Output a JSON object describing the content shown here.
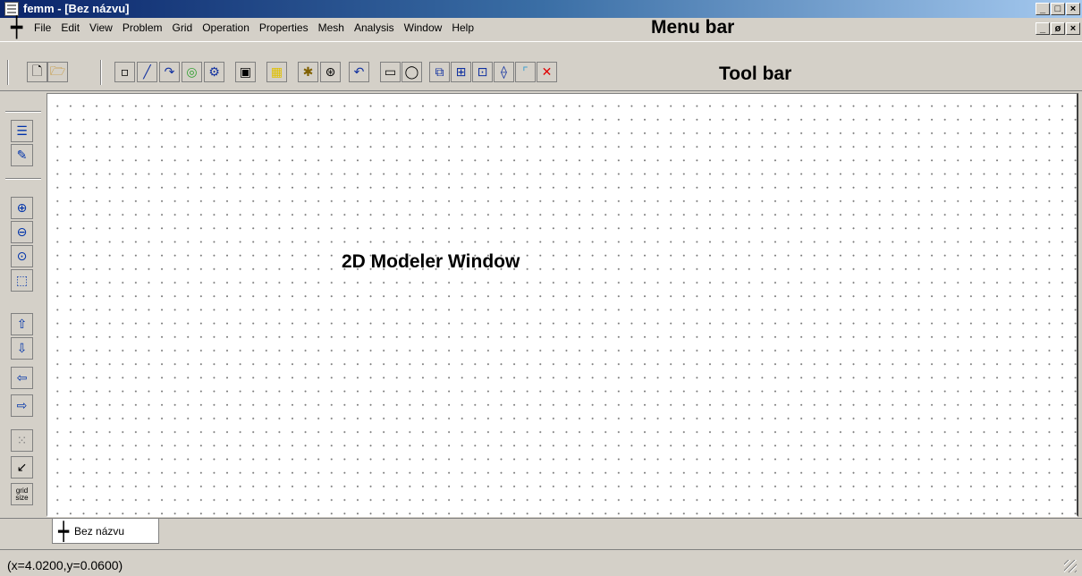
{
  "window": {
    "title": "femm - [Bez názvu]"
  },
  "caption_buttons": {
    "minimize": "_",
    "maximize": "□",
    "close": "×",
    "restore": "ø"
  },
  "menu": {
    "items": [
      {
        "label": "File"
      },
      {
        "label": "Edit"
      },
      {
        "label": "View"
      },
      {
        "label": "Problem"
      },
      {
        "label": "Grid"
      },
      {
        "label": "Operation"
      },
      {
        "label": "Properties"
      },
      {
        "label": "Mesh"
      },
      {
        "label": "Analysis"
      },
      {
        "label": "Window"
      },
      {
        "label": "Help"
      }
    ]
  },
  "annotations": {
    "menu_bar": "Menu bar",
    "tool_bar": "Tool bar",
    "modeler": "2D Modeler Window"
  },
  "toolbar_icons": [
    "new-file-icon",
    "open-folder-icon",
    "node-icon",
    "segment-icon",
    "arc-segment-icon",
    "block-label-icon",
    "group-icon",
    "properties-icon",
    "select-region-icon",
    "mesh-icon",
    "analyze-icon",
    "undo-icon",
    "select-rectangle-icon",
    "select-circle-icon",
    "copy-icon",
    "move-icon",
    "scale-icon",
    "mirror-icon",
    "fillet-icon",
    "delete-icon"
  ],
  "sidebar": {
    "grid_size_label": "grid size"
  },
  "tab": {
    "label": "Bez názvu"
  },
  "status": {
    "coordinates": "(x=4.0200,y=0.0600)"
  },
  "colors": {
    "title_start": "#0a246a",
    "title_end": "#a6caf0",
    "chrome": "#d4d0c8"
  }
}
